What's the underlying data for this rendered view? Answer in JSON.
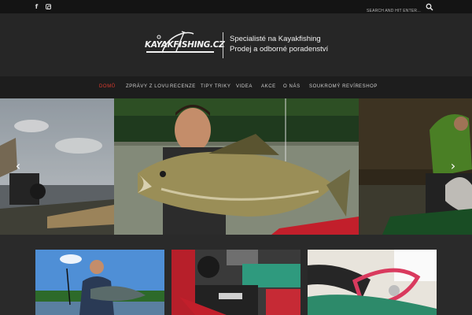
{
  "topbar": {
    "social": [
      {
        "name": "facebook-icon",
        "glyph": "f"
      },
      {
        "name": "instagram-icon",
        "glyph": ""
      }
    ],
    "search_placeholder": "SEARCH AND HIT ENTER..."
  },
  "header": {
    "logo_text": "KAYAKFISHING.CZ",
    "tagline_line1": "Specialisté na Kayakfishing",
    "tagline_line2": "Prodej a odborné poradenství"
  },
  "nav": {
    "items": [
      "DOMŮ",
      "ZPRÁVY Z LOVU",
      "RECENZE",
      "TIPY TRIKY",
      "VIDEA",
      "AKCE",
      "O NÁS",
      "SOUKROMÝ REVÍR",
      "ESHOP"
    ],
    "active_index": 0
  },
  "slider": {
    "prev_glyph": "‹",
    "next_glyph": "›"
  },
  "colors": {
    "accent": "#e23b2e",
    "topbar": "#141414",
    "header": "#262626",
    "nav": "#1d1d1d"
  }
}
